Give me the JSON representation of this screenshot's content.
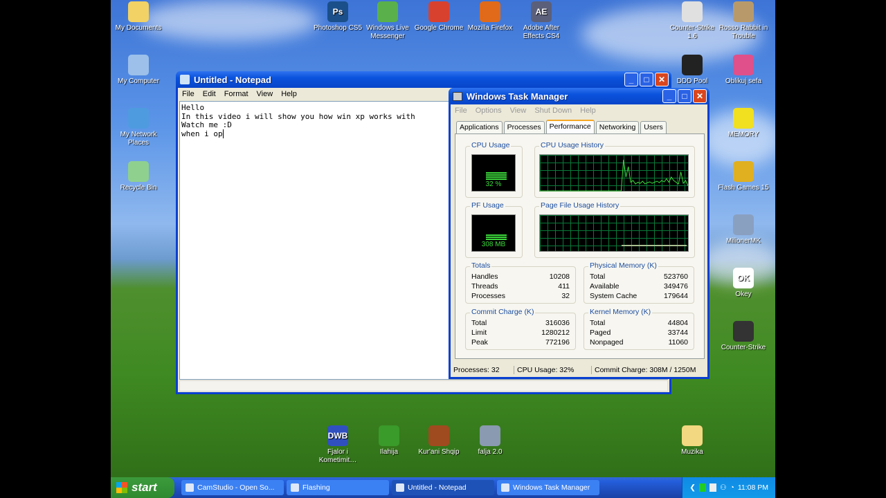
{
  "desktop_icons": [
    {
      "label": "My Documents",
      "icon": "folder-documents-icon",
      "color": "#f2d264"
    },
    {
      "label": "My Computer",
      "icon": "computer-icon",
      "color": "#9cc0ea"
    },
    {
      "label": "My Network Places",
      "icon": "network-icon",
      "color": "#4f9be0"
    },
    {
      "label": "Recycle Bin",
      "icon": "recycle-bin-icon",
      "color": "#8fd08f"
    },
    {
      "label": "Photoshop CS5",
      "icon": "photoshop-icon",
      "glyph": "Ps",
      "color": "#1b4f8a"
    },
    {
      "label": "Windows Live Messenger",
      "icon": "messenger-icon",
      "color": "#5ab04a"
    },
    {
      "label": "Google Chrome",
      "icon": "chrome-icon",
      "color": "#d9412f"
    },
    {
      "label": "Mozilla Firefox",
      "icon": "firefox-icon",
      "color": "#e06a1a"
    },
    {
      "label": "Adobe After Effects CS4",
      "icon": "after-effects-icon",
      "glyph": "AE",
      "color": "#5b5f7a"
    },
    {
      "label": "Counter-Strike 1.6",
      "icon": "counter-strike-icon",
      "color": "#e0e0e0"
    },
    {
      "label": "Rosso Rabbit in Trouble",
      "icon": "rabbit-icon",
      "color": "#b89a6a"
    },
    {
      "label": "DDD Pool",
      "icon": "pool-ball-icon",
      "color": "#222222"
    },
    {
      "label": "Oblikuj sefa",
      "icon": "oblikuj-icon",
      "color": "#e0508a"
    },
    {
      "label": "MEMORY",
      "icon": "memory-game-icon",
      "color": "#f0e020"
    },
    {
      "label": "Flash Games 15",
      "icon": "cd-icon",
      "color": "#e0b020"
    },
    {
      "label": "MilionerMK",
      "icon": "flash-icon",
      "color": "#8aa0c0"
    },
    {
      "label": "Okey",
      "icon": "okey-icon",
      "glyph": "OK",
      "color": "#ffffff"
    },
    {
      "label": "Counter-Strike",
      "icon": "counter-strike-icon",
      "color": "#333333"
    },
    {
      "label": "Fjalor i Kometimit…",
      "icon": "dwb-icon",
      "glyph": "DWB",
      "color": "#3050c0"
    },
    {
      "label": "Ilahija",
      "icon": "tree-icon",
      "color": "#3a9a2a"
    },
    {
      "label": "Kur'ani Shqip",
      "icon": "book-icon",
      "color": "#a04a20"
    },
    {
      "label": "falja 2.0",
      "icon": "flash-icon",
      "color": "#8a9ab0"
    },
    {
      "label": "Muzika",
      "icon": "folder-icon",
      "color": "#f2d880"
    }
  ],
  "notepad": {
    "title": "Untitled - Notepad",
    "menu": [
      "File",
      "Edit",
      "Format",
      "View",
      "Help"
    ],
    "lines": [
      "Hello",
      "In this video i will show you how win xp works with",
      "Watch me :D",
      "when i op"
    ]
  },
  "taskmgr": {
    "title": "Windows Task Manager",
    "menu": [
      "File",
      "Options",
      "View",
      "Shut Down",
      "Help"
    ],
    "tabs": [
      "Applications",
      "Processes",
      "Performance",
      "Networking",
      "Users"
    ],
    "active_tab": "Performance",
    "cpu_usage": {
      "label": "CPU Usage",
      "value": "32 %",
      "percent": 32
    },
    "cpu_history": {
      "label": "CPU Usage History",
      "values": [
        0,
        0,
        0,
        0,
        0,
        0,
        0,
        0,
        0,
        0,
        0,
        0,
        0,
        0,
        0,
        0,
        0,
        0,
        0,
        0,
        0,
        0,
        0,
        0,
        0,
        0,
        0,
        0,
        0,
        0,
        0,
        0,
        0,
        0,
        0,
        90,
        40,
        70,
        25,
        30,
        20,
        25,
        22,
        28,
        20,
        24,
        26,
        22,
        25,
        28,
        24,
        30,
        26,
        35,
        25,
        40,
        30,
        25,
        20,
        55,
        22,
        30,
        15
      ]
    },
    "pf_usage": {
      "label": "PF Usage",
      "value": "308 MB",
      "percent": 25
    },
    "pf_history": {
      "label": "Page File Usage History"
    },
    "totals": {
      "label": "Totals",
      "rows": [
        [
          "Handles",
          "10208"
        ],
        [
          "Threads",
          "411"
        ],
        [
          "Processes",
          "32"
        ]
      ]
    },
    "physical": {
      "label": "Physical Memory (K)",
      "rows": [
        [
          "Total",
          "523760"
        ],
        [
          "Available",
          "349476"
        ],
        [
          "System Cache",
          "179644"
        ]
      ]
    },
    "commit": {
      "label": "Commit Charge (K)",
      "rows": [
        [
          "Total",
          "316036"
        ],
        [
          "Limit",
          "1280212"
        ],
        [
          "Peak",
          "772196"
        ]
      ]
    },
    "kernel": {
      "label": "Kernel Memory (K)",
      "rows": [
        [
          "Total",
          "44804"
        ],
        [
          "Paged",
          "33744"
        ],
        [
          "Nonpaged",
          "11060"
        ]
      ]
    },
    "status": {
      "processes": "Processes: 32",
      "cpu": "CPU Usage: 32%",
      "commit": "Commit Charge: 308M / 1250M"
    }
  },
  "taskbar": {
    "start": "start",
    "items": [
      "CamStudio - Open So...",
      "Flashing",
      "Untitled - Notepad",
      "Windows Task Manager"
    ],
    "active": 2,
    "clock": "11:08 PM"
  }
}
